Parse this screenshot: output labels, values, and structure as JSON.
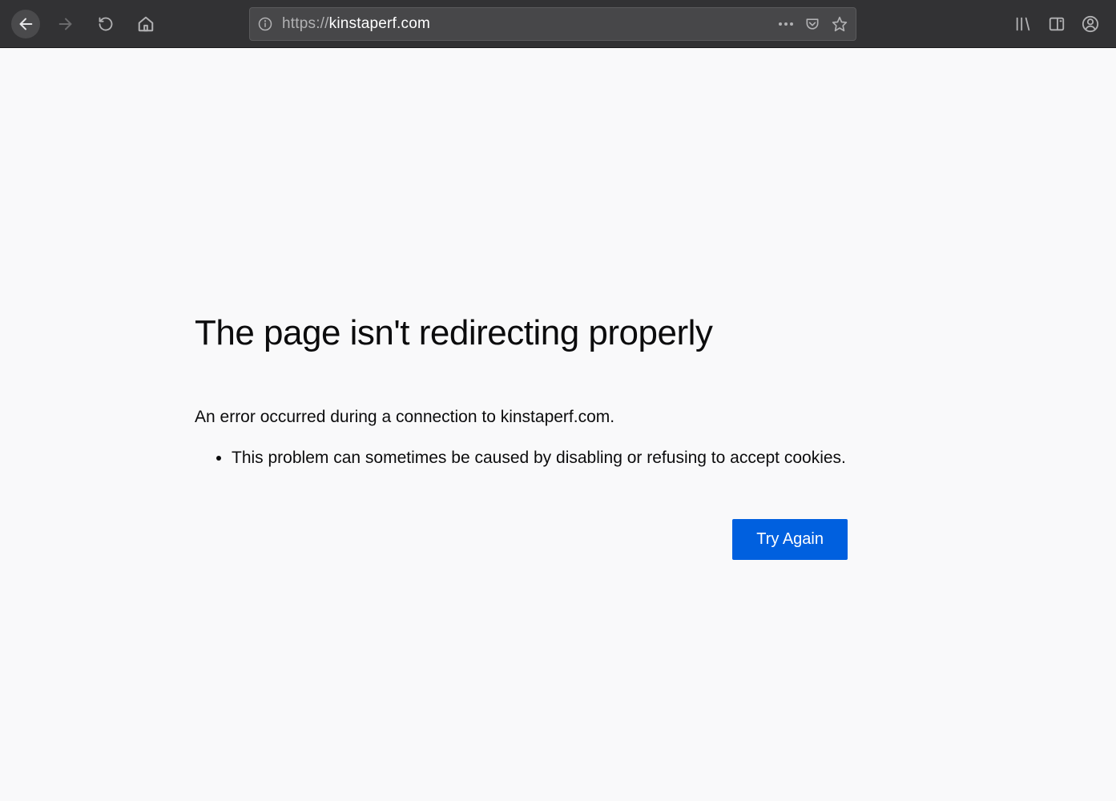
{
  "toolbar": {
    "url_protocol": "https://",
    "url_domain": "kinstaperf.com",
    "url_path": ""
  },
  "error": {
    "title": "The page isn't redirecting properly",
    "message": "An error occurred during a connection to kinstaperf.com.",
    "list_item": "This problem can sometimes be caused by disabling or refusing to accept cookies.",
    "try_again_label": "Try Again"
  }
}
